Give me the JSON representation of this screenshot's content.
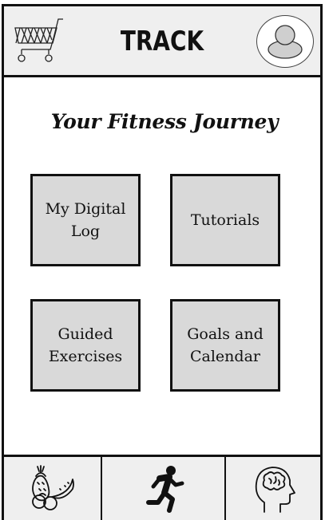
{
  "header": {
    "title": "TRACK",
    "left_icon": "shopping-cart-icon",
    "right_icon": "user-avatar-icon"
  },
  "main": {
    "heading": "Your Fitness Journey",
    "tiles": [
      {
        "label_line1": "My Digital",
        "label_line2": "Log"
      },
      {
        "label_line1": "Tutorials",
        "label_line2": ""
      },
      {
        "label_line1": "Guided",
        "label_line2": "Exercises"
      },
      {
        "label_line1": "Goals and",
        "label_line2": "Calendar"
      }
    ]
  },
  "bottom_nav": {
    "items": [
      {
        "icon": "fruit-icon"
      },
      {
        "icon": "running-person-icon"
      },
      {
        "icon": "brain-head-icon"
      }
    ]
  },
  "colors": {
    "border": "#111111",
    "header_bg": "#efefef",
    "tile_bg": "#d9d9d9",
    "avatar_fill": "#cccccc"
  }
}
